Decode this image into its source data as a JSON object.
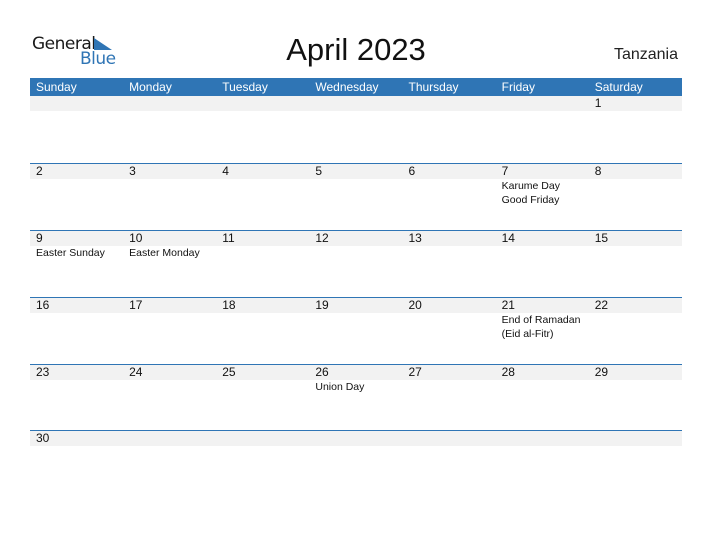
{
  "logo": {
    "word1": "General",
    "word2": "Blue",
    "brand_color": "#2f75b5"
  },
  "title": "April 2023",
  "country": "Tanzania",
  "weekdays": [
    "Sunday",
    "Monday",
    "Tuesday",
    "Wednesday",
    "Thursday",
    "Friday",
    "Saturday"
  ],
  "weeks": [
    {
      "days": [
        "",
        "",
        "",
        "",
        "",
        "",
        "1"
      ],
      "events": [
        "",
        "",
        "",
        "",
        "",
        "",
        ""
      ]
    },
    {
      "days": [
        "2",
        "3",
        "4",
        "5",
        "6",
        "7",
        "8"
      ],
      "events": [
        "",
        "",
        "",
        "",
        "",
        "Karume Day\n  Good Friday",
        ""
      ]
    },
    {
      "days": [
        "9",
        "10",
        "11",
        "12",
        "13",
        "14",
        "15"
      ],
      "events": [
        "Easter Sunday",
        "Easter Monday",
        "",
        "",
        "",
        "",
        ""
      ]
    },
    {
      "days": [
        "16",
        "17",
        "18",
        "19",
        "20",
        "21",
        "22"
      ],
      "events": [
        "",
        "",
        "",
        "",
        "",
        "End of Ramadan\n(Eid al-Fitr)",
        ""
      ]
    },
    {
      "days": [
        "23",
        "24",
        "25",
        "26",
        "27",
        "28",
        "29"
      ],
      "events": [
        "",
        "",
        "",
        "Union Day",
        "",
        "",
        ""
      ]
    },
    {
      "days": [
        "30",
        "",
        "",
        "",
        "",
        "",
        ""
      ],
      "events": [
        "",
        "",
        "",
        "",
        "",
        "",
        ""
      ]
    }
  ],
  "colors": {
    "header_bg": "#2f75b5",
    "date_strip_bg": "#f2f2f2"
  }
}
